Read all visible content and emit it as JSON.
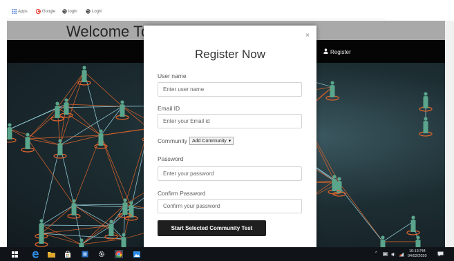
{
  "bookmarks": [
    {
      "label": "Apps",
      "icon": "apps-grid-icon"
    },
    {
      "label": "Google",
      "icon": "google-icon"
    },
    {
      "label": "login",
      "icon": "globe-icon"
    },
    {
      "label": "Login",
      "icon": "globe-icon"
    }
  ],
  "site": {
    "banner_title": "Welcome To",
    "nav_register": "Register"
  },
  "modal": {
    "close_label": "×",
    "title": "Register Now",
    "username": {
      "label": "User name",
      "placeholder": "Enter user name"
    },
    "email": {
      "label": "Email ID",
      "placeholder": "Enter your Email id"
    },
    "community": {
      "label": "Community",
      "selected": "Add Community",
      "arrow": "▾"
    },
    "password": {
      "label": "Password",
      "placeholder": "Enter your password"
    },
    "confirm": {
      "label": "Confirm Password",
      "placeholder": "Confirm your password"
    },
    "submit_label": "Start Selected Community Test"
  },
  "taskbar": {
    "time": "10:13 PM",
    "date": "04/02/2020",
    "tray_up": "^"
  },
  "colors": {
    "navbar": "#050505",
    "banner": "#a9a9a9",
    "button": "#1f1f1f",
    "network_line": "#e0642b",
    "network_node": "#5aa58c"
  }
}
